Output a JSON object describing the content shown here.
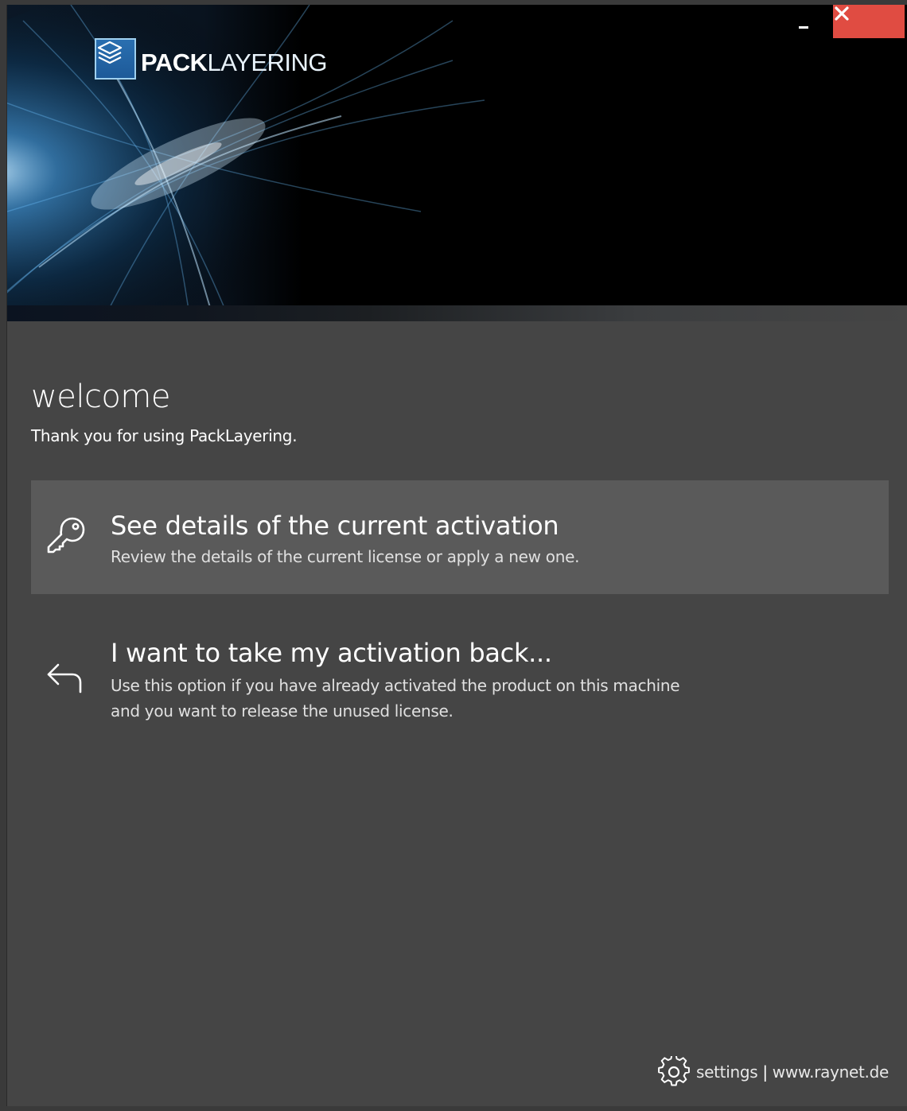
{
  "app": {
    "logo_bold": "PACK",
    "logo_light": "LAYERING"
  },
  "window_controls": {
    "close_symbol": "✕"
  },
  "welcome": {
    "title": "welcome",
    "subtitle": "Thank you for using PackLayering."
  },
  "options": [
    {
      "icon": "key-icon",
      "title": "See details of the current activation",
      "description": "Review the details of the current license or apply a new one.",
      "highlighted": true
    },
    {
      "icon": "return-arrow-icon",
      "title": "I want to take my activation back...",
      "description_line1": "Use this option if you have already activated the product on this machine",
      "description_line2": "and you want to release the unused license.",
      "highlighted": false
    }
  ],
  "footer": {
    "settings_label": "settings",
    "separator": "|",
    "website_label": "www.raynet.de"
  },
  "colors": {
    "close_button": "#e04c42",
    "content_background": "#454545",
    "highlight_option": "#5a5a5a",
    "banner_glow": "#4fb3ff"
  }
}
